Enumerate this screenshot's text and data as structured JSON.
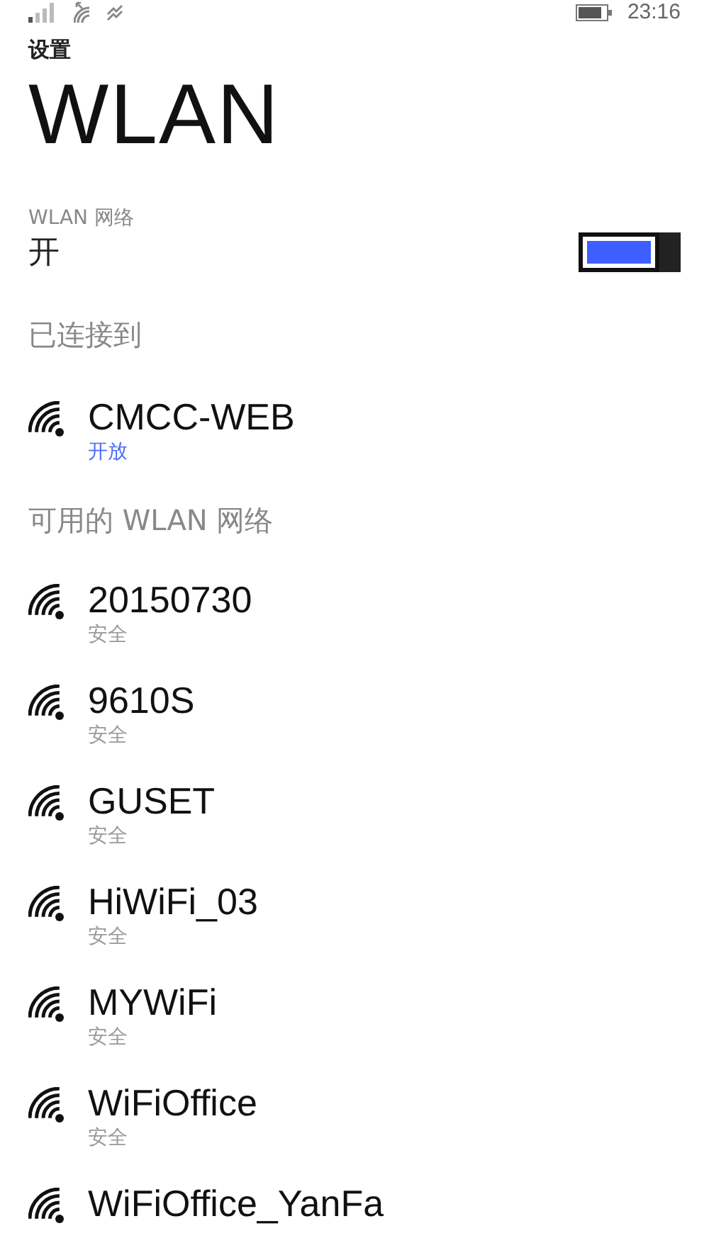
{
  "status_bar": {
    "time": "23:16"
  },
  "header": {
    "app": "设置",
    "title": "WLAN"
  },
  "wlan_toggle": {
    "label": "WLAN 网络",
    "value": "开",
    "on": true
  },
  "connected": {
    "heading": "已连接到",
    "networks": [
      {
        "name": "CMCC-WEB",
        "status": "开放"
      }
    ]
  },
  "available": {
    "heading": "可用的 WLAN 网络",
    "networks": [
      {
        "name": "20150730",
        "status": "安全"
      },
      {
        "name": "9610S",
        "status": "安全"
      },
      {
        "name": "GUSET",
        "status": "安全"
      },
      {
        "name": "HiWiFi_03",
        "status": "安全"
      },
      {
        "name": "MYWiFi",
        "status": "安全"
      },
      {
        "name": "WiFiOffice",
        "status": "安全"
      },
      {
        "name": "WiFiOffice_YanFa"
      }
    ]
  }
}
